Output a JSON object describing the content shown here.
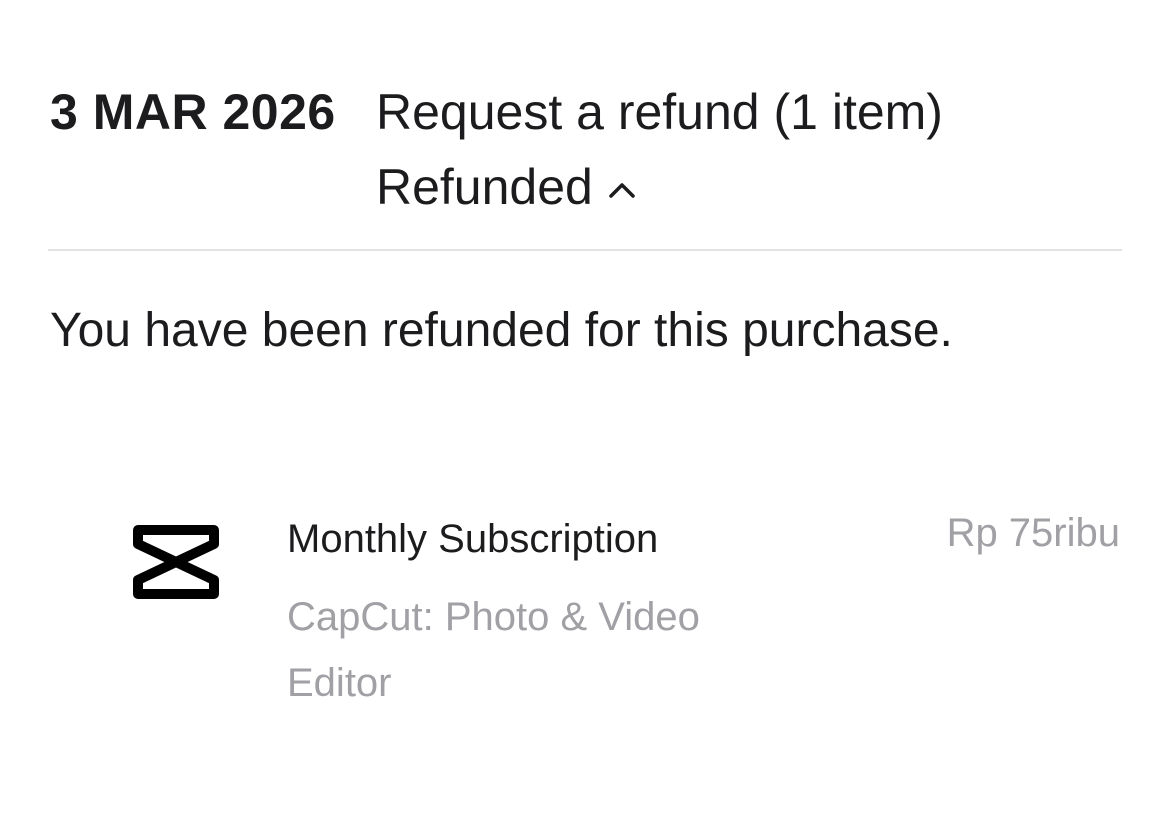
{
  "purchase": {
    "date": "3 MAR 2026",
    "title": "Request a refund (1 item)",
    "status": "Refunded",
    "status_icon": "chevron-up-icon",
    "message": "You have been refunded for this purchase."
  },
  "item": {
    "name": "Monthly Subscription",
    "app_name": "CapCut: Photo & Video Editor",
    "price": "Rp 75ribu",
    "icon": "capcut-logo-icon"
  },
  "colors": {
    "primary_text": "#1c1c1e",
    "secondary_text": "#a0a0a5",
    "divider": "#e2e2e4"
  }
}
